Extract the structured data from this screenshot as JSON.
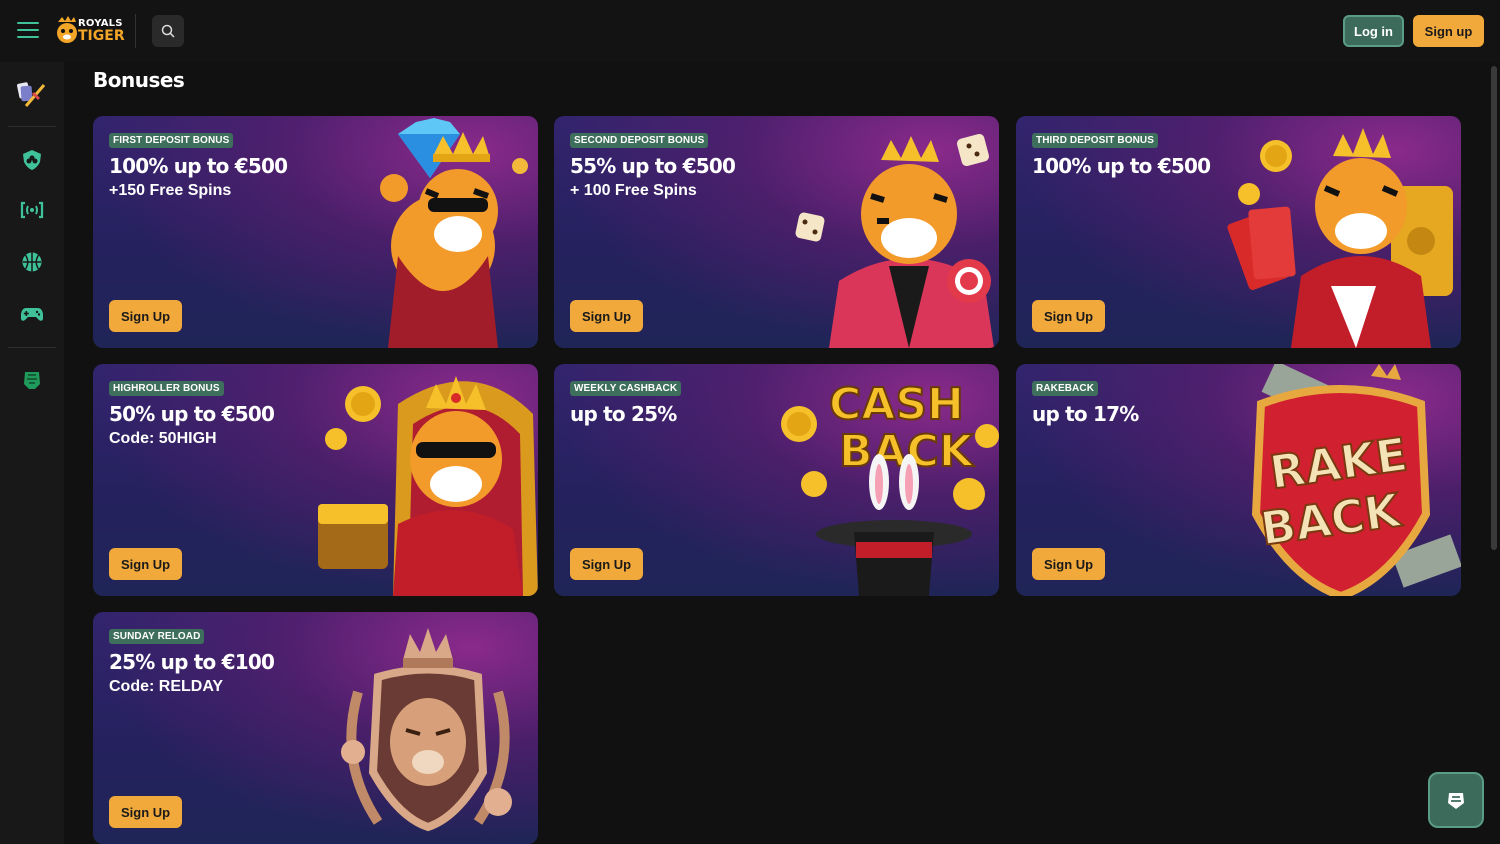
{
  "header": {
    "logo_line1": "ROYALS",
    "logo_line2": "TIGER",
    "login_label": "Log in",
    "signup_label": "Sign up"
  },
  "page_title": "Bonuses",
  "cards": [
    {
      "badge": "FIRST DEPOSIT BONUS",
      "title": "100% up to €500",
      "subtitle": "+150 Free Spins",
      "cta": "Sign Up",
      "art": "tiger-diamond-illustration"
    },
    {
      "badge": "SECOND DEPOSIT BONUS",
      "title": "55% up to €500",
      "subtitle": "+ 100 Free Spins",
      "cta": "Sign Up",
      "art": "tiger-dice-illustration"
    },
    {
      "badge": "THIRD DEPOSIT BONUS",
      "title": "100% up to €500",
      "subtitle": "",
      "cta": "Sign Up",
      "art": "tiger-cash-safe-illustration"
    },
    {
      "badge": "HIGHROLLER BONUS",
      "title": "50% up to €500",
      "subtitle": "Code: 50HIGH",
      "cta": "Sign Up",
      "art": "tiger-throne-illustration"
    },
    {
      "badge": "WEEKLY CASHBACK",
      "title": "up to 25%",
      "subtitle": "",
      "cta": "Sign Up",
      "art_text_1": "CASH",
      "art_text_2": "BACK",
      "art": "cashback-hat-illustration"
    },
    {
      "badge": "RAKEBACK",
      "title": "up to 17%",
      "subtitle": "",
      "cta": "Sign Up",
      "art_text_1": "RAKE",
      "art_text_2": "BACK",
      "art": "rakeback-shield-illustration"
    },
    {
      "badge": "SUNDAY RELOAD",
      "title": "25% up to €100",
      "subtitle": "Code: RELDAY",
      "cta": "Sign Up",
      "art": "tiger-crest-illustration"
    }
  ],
  "colors": {
    "accent_green": "#3fc29a",
    "button_gold": "#f2a93b",
    "badge_green": "#3e6e5c"
  }
}
